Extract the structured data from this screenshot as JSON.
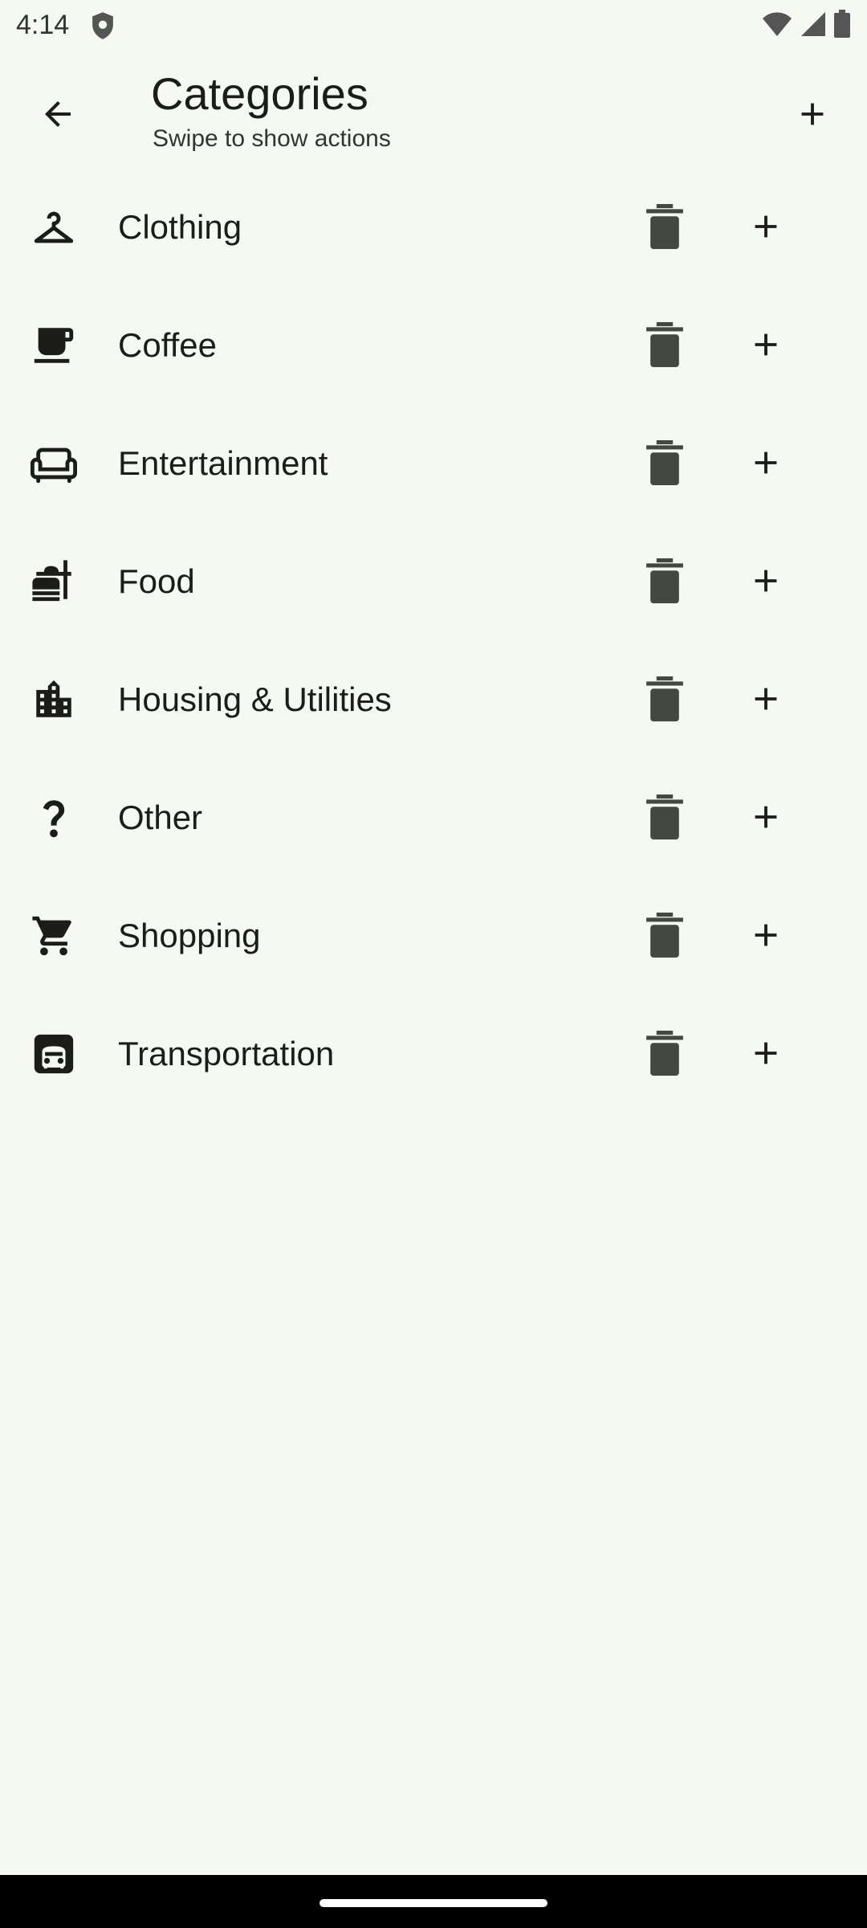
{
  "status_bar": {
    "time": "4:14"
  },
  "app_bar": {
    "title": "Categories",
    "subtitle": "Swipe to show actions"
  },
  "categories": [
    {
      "label": "Clothing",
      "icon": "hanger-icon"
    },
    {
      "label": "Coffee",
      "icon": "coffee-cup-icon"
    },
    {
      "label": "Entertainment",
      "icon": "sofa-icon"
    },
    {
      "label": "Food",
      "icon": "fastfood-icon"
    },
    {
      "label": "Housing & Utilities",
      "icon": "building-icon"
    },
    {
      "label": "Other",
      "icon": "question-mark-icon"
    },
    {
      "label": "Shopping",
      "icon": "shopping-cart-icon"
    },
    {
      "label": "Transportation",
      "icon": "train-icon"
    }
  ],
  "colors": {
    "background": "#f6f9f1",
    "icon": "#1c1d1a",
    "action_icon": "#44483f"
  }
}
